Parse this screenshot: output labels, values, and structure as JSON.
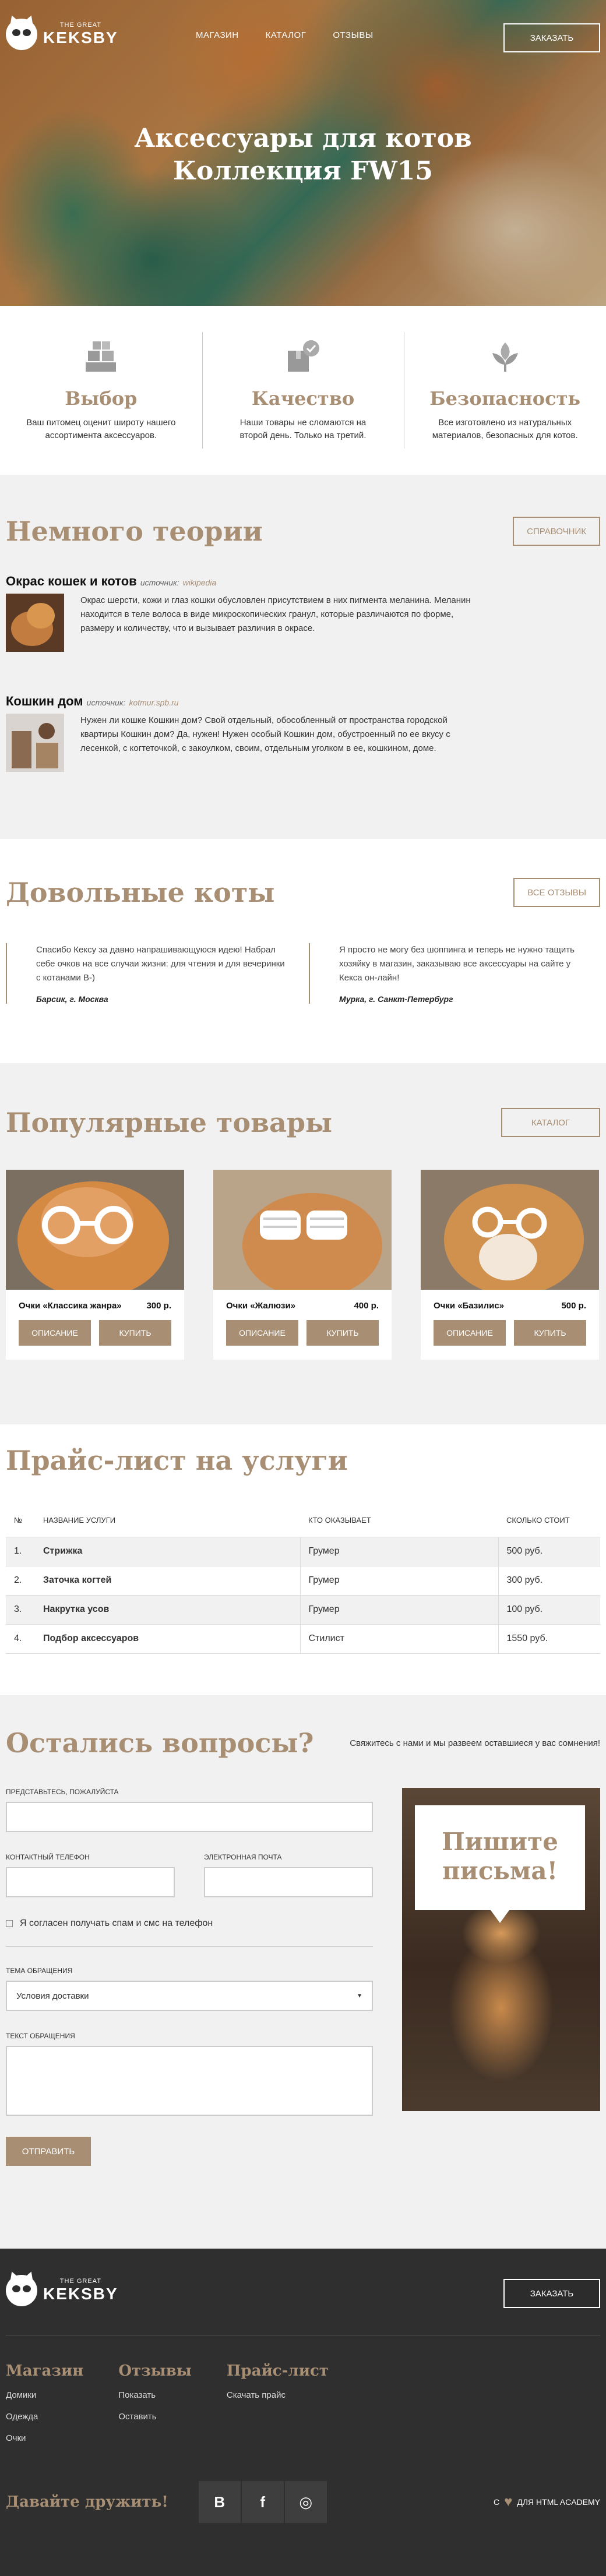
{
  "header": {
    "logo_small": "THE GREAT",
    "logo_big": "KEKSBY",
    "nav": [
      "МАГАЗИН",
      "КАТАЛОГ",
      "ОТЗЫВЫ"
    ],
    "order_button": "ЗАКАЗАТЬ",
    "hero_line1": "Аксессуары для котов",
    "hero_line2": "Коллекция FW15"
  },
  "features": [
    {
      "icon": "boxes-icon",
      "title": "Выбор",
      "text": "Ваш питомец оценит широту нашего ассортимента аксессуаров."
    },
    {
      "icon": "quality-box-icon",
      "title": "Качество",
      "text": "Наши товары не сломаются на второй день. Только на третий."
    },
    {
      "icon": "leaf-icon",
      "title": "Безопасность",
      "text": "Все изготовлено из натуральных материалов, безопасных для котов."
    }
  ],
  "theory": {
    "title": "Немного теории",
    "button": "СПРАВОЧНИК",
    "articles": [
      {
        "title": "Окрас кошек и котов",
        "source_label": "источник:",
        "source": "wikipedia",
        "text": "Окрас шерсти, кожи и глаз кошки обусловлен присутствием в них пигмента меланина. Меланин находится в теле волоса в виде микроскопических гранул, которые различаются по форме, размеру и количеству, что и вызывает различия в окрасе."
      },
      {
        "title": "Кошкин дом",
        "source_label": "источник:",
        "source": "kotmur.spb.ru",
        "text": "Нужен ли кошке Кошкин дом? Свой отдельный, обособленный от пространства городской квартиры Кошкин дом? Да, нужен! Нужен особый Кошкин дом, обустроенный по ее вкусу с лесенкой, с когтеточкой, с закоулком, своим, отдельным уголком в ее, кошкином, доме."
      }
    ]
  },
  "reviews": {
    "title": "Довольные коты",
    "button": "ВСЕ ОТЗЫВЫ",
    "items": [
      {
        "text": "Спасибо Кексу за давно напрашивающуюся идею! Набрал себе очков на все случаи жизни: для чтения и для вечеринки с котанами B-)",
        "author": "Барсик, г. Москва"
      },
      {
        "text": "Я просто не могу без шоппинга и теперь не нужно тащить хозяйку в магазин, заказываю все аксессуары на сайте у Кекса он-лайн!",
        "author": "Мурка, г. Санкт-Петербург"
      }
    ]
  },
  "products": {
    "title": "Популярные товары",
    "button": "КАТАЛОГ",
    "desc_label": "ОПИСАНИЕ",
    "buy_label": "КУПИТЬ",
    "items": [
      {
        "name": "Очки «Классика жанра»",
        "price": "300 р."
      },
      {
        "name": "Очки «Жалюзи»",
        "price": "400 р."
      },
      {
        "name": "Очки «Базилис»",
        "price": "500 р."
      }
    ]
  },
  "prices": {
    "title": "Прайс-лист на услуги",
    "columns": [
      "№",
      "НАЗВАНИЕ УСЛУГИ",
      "КТО ОКАЗЫВАЕТ",
      "СКОЛЬКО СТОИТ"
    ],
    "rows": [
      [
        "1.",
        "Стрижка",
        "Грумер",
        "500 руб."
      ],
      [
        "2.",
        "Заточка когтей",
        "Грумер",
        "300 руб."
      ],
      [
        "3.",
        "Накрутка усов",
        "Грумер",
        "100 руб."
      ],
      [
        "4.",
        "Подбор аксессуаров",
        "Стилист",
        "1550 руб."
      ]
    ]
  },
  "feedback": {
    "title": "Остались вопросы?",
    "subtitle": "Свяжитесь с нами и мы развеем оставшиеся у вас сомнения!",
    "name_label": "ПРЕДСТАВЬТЕСЬ, ПОЖАЛУЙСТА",
    "phone_label": "КОНТАКТНЫЙ ТЕЛЕФОН",
    "email_label": "ЭЛЕКТРОННАЯ ПОЧТА",
    "consent": "Я согласен получать спам и смс на телефон",
    "topic_label": "ТЕМА ОБРАЩЕНИЯ",
    "topic_value": "Условия доставки",
    "text_label": "ТЕКСТ ОБРАЩЕНИЯ",
    "send": "ОТПРАВИТЬ",
    "card_line1": "Пишите",
    "card_line2": "письма!"
  },
  "footer": {
    "logo_small": "THE GREAT",
    "logo_big": "KEKSBY",
    "order_button": "ЗАКАЗАТЬ",
    "cols": [
      {
        "title": "Магазин",
        "items": [
          "Домики",
          "Одежда",
          "Очки"
        ]
      },
      {
        "title": "Отзывы",
        "items": [
          "Показать",
          "Оставить"
        ]
      },
      {
        "title": "Прайс-лист",
        "items": [
          "Скачать прайс"
        ]
      }
    ],
    "friends": "Давайте дружить!",
    "social": [
      "B",
      "f",
      "◎"
    ],
    "copy_pre": "С",
    "copy_post": "ДЛЯ HTML ACADEMY"
  },
  "colors": {
    "accent": "#a88e73",
    "footer_bg": "#2f2f2f",
    "section_gray": "#f1f1f1"
  }
}
